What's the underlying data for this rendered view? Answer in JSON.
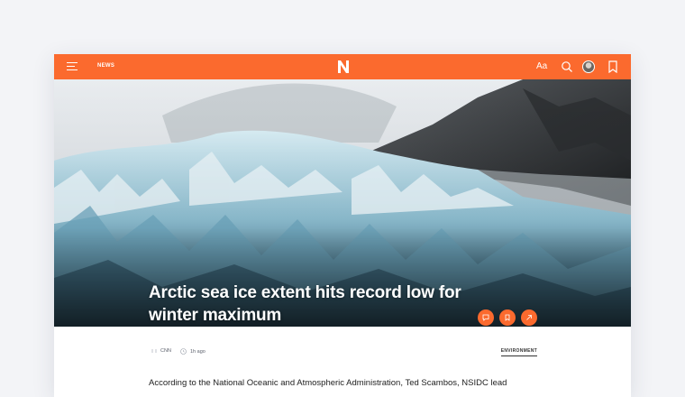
{
  "topbar": {
    "section_label": "NEWS",
    "logo_letter": "N",
    "font_size_label": "Aa"
  },
  "article": {
    "headline": "Arctic sea ice extent hits record low for winter maximum",
    "source": "CNN",
    "time_ago": "1h ago",
    "tag": "ENVIRONMENT",
    "body_first_line": "According to the National Oceanic and Atmospheric Administration, Ted Scambos, NSIDC lead"
  },
  "colors": {
    "accent": "#fb6a2e",
    "background": "#f3f4f7",
    "text": "#222222"
  },
  "icons": {
    "menu": "menu-icon",
    "search": "search-icon",
    "bookmark": "bookmark-icon",
    "comment": "comment-icon",
    "share": "share-arrow-icon"
  }
}
